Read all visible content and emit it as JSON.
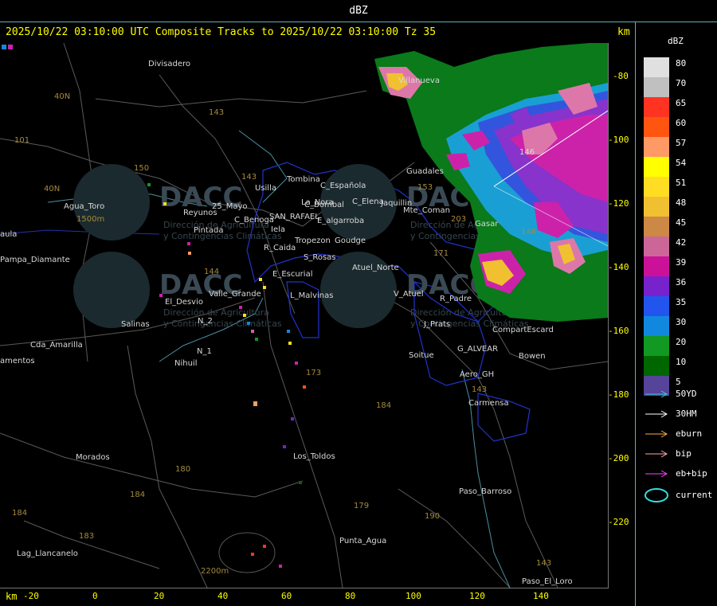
{
  "header": {
    "title": "dBZ",
    "subtitle": "2025/10/22 03:10:00 UTC Composite Tracks to 2025/10/22 03:10:00 Tz 35",
    "km_top": "km",
    "km_bottom": "km"
  },
  "x_axis": {
    "ticks": [
      "-20",
      "0",
      "20",
      "40",
      "60",
      "80",
      "100",
      "120",
      "140"
    ]
  },
  "y_axis": {
    "ticks": [
      "-80",
      "-100",
      "-120",
      "-140",
      "-160",
      "-180",
      "-200",
      "-220"
    ]
  },
  "legend": {
    "title": "dBZ",
    "items": [
      {
        "label": "80",
        "color": "#e0e0e0"
      },
      {
        "label": "70",
        "color": "#c0c0c0"
      },
      {
        "label": "65",
        "color": "#ff3322"
      },
      {
        "label": "60",
        "color": "#ff5511"
      },
      {
        "label": "57",
        "color": "#ff9966"
      },
      {
        "label": "54",
        "color": "#ffff00"
      },
      {
        "label": "51",
        "color": "#ffdd22"
      },
      {
        "label": "48",
        "color": "#f0c030"
      },
      {
        "label": "45",
        "color": "#cc8844"
      },
      {
        "label": "42",
        "color": "#cc6699"
      },
      {
        "label": "39",
        "color": "#cc1199"
      },
      {
        "label": "36",
        "color": "#7722cc"
      },
      {
        "label": "35",
        "color": "#2255ee"
      },
      {
        "label": "30",
        "color": "#1188dd"
      },
      {
        "label": "20",
        "color": "#119922"
      },
      {
        "label": "10",
        "color": "#006600"
      },
      {
        "label": "5",
        "color": "#554499"
      }
    ]
  },
  "tracks": [
    {
      "label": "50YD",
      "color": "#33ccdd"
    },
    {
      "label": "30HM",
      "color": "#ffffff"
    },
    {
      "label": "eburn",
      "color": "#ffaa44"
    },
    {
      "label": "bip",
      "color": "#ffaaaa"
    },
    {
      "label": "eb+bip",
      "color": "#ff44ff"
    }
  ],
  "current_label": "current",
  "current_color": "#33dddd",
  "watermark": {
    "logo": "DACC",
    "line1": "Dirección de Agricultura",
    "line2": "y Contingencias Climáticas"
  },
  "places": [
    {
      "name": "Divisadero"
    },
    {
      "name": "Villanueva"
    },
    {
      "name": "Reyunos"
    },
    {
      "name": "25_Mayo"
    },
    {
      "name": "Agua_Toro"
    },
    {
      "name": "Pampa_Diamante"
    },
    {
      "name": "Pintada"
    },
    {
      "name": "Usilla"
    },
    {
      "name": "Tombina"
    },
    {
      "name": "C_Española"
    },
    {
      "name": "La_Nora"
    },
    {
      "name": "C_Elena"
    },
    {
      "name": "C_Benoga"
    },
    {
      "name": "SAN_RAFAEL"
    },
    {
      "name": "E_algarroba"
    },
    {
      "name": "C_Bombal"
    },
    {
      "name": "Iela"
    },
    {
      "name": "Tropezon"
    },
    {
      "name": "Goudge"
    },
    {
      "name": "R_Caida"
    },
    {
      "name": "S_Rosas"
    },
    {
      "name": "Guadales"
    },
    {
      "name": "Jaquillin"
    },
    {
      "name": "Mte_Coman"
    },
    {
      "name": "Gasar"
    },
    {
      "name": "Atuel_Norte"
    },
    {
      "name": "E_Escurial"
    },
    {
      "name": "Valle_Grande"
    },
    {
      "name": "El_Desvio"
    },
    {
      "name": "L_Malvinas"
    },
    {
      "name": "V_Atuel"
    },
    {
      "name": "R_Padre"
    },
    {
      "name": "J_Prats"
    },
    {
      "name": "CompartEscard"
    },
    {
      "name": "Salinas"
    },
    {
      "name": "N_2"
    },
    {
      "name": "N_1"
    },
    {
      "name": "Nihuil"
    },
    {
      "name": "Cda_Amarilla"
    },
    {
      "name": "amentos"
    },
    {
      "name": "G_ALVEAR"
    },
    {
      "name": "Soitue"
    },
    {
      "name": "Bowen"
    },
    {
      "name": "Aero_GH"
    },
    {
      "name": "Carmensa"
    },
    {
      "name": "Los_Toldos"
    },
    {
      "name": "Morados"
    },
    {
      "name": "Paso_Barroso"
    },
    {
      "name": "Punta_Agua"
    },
    {
      "name": "Lag_Llancanelo"
    },
    {
      "name": "Paso_El_Loro"
    },
    {
      "name": "aula"
    }
  ],
  "roads": [
    "143",
    "101",
    "40N",
    "40N",
    "150",
    "143",
    "153",
    "203",
    "171",
    "146",
    "144",
    "173",
    "184",
    "180",
    "184",
    "183",
    "184",
    "179",
    "190",
    "143",
    "143"
  ],
  "terrain_labels": [
    "1500m",
    "2200m"
  ],
  "storm_label": "146"
}
